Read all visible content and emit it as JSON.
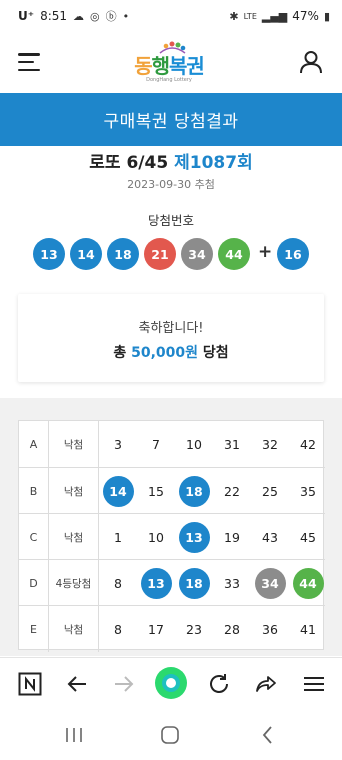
{
  "status_bar": {
    "carrier": "U⁺",
    "time": "8:51",
    "network": "LTE",
    "battery": "47%"
  },
  "header": {
    "logo_text_1": "동",
    "logo_text_2": "행",
    "logo_text_3": "복권",
    "logo_sub": "DongHang Lottery"
  },
  "title_bar": {
    "title": "구매복권 당첨결과"
  },
  "draw": {
    "name": "로또 6/45",
    "number": "제1087회",
    "date": "2023-09-30 추첨"
  },
  "winning": {
    "label": "당첨번호",
    "plus": "+",
    "balls": [
      {
        "n": "13",
        "color": "#1e86cb"
      },
      {
        "n": "14",
        "color": "#1e86cb"
      },
      {
        "n": "18",
        "color": "#1e86cb"
      },
      {
        "n": "21",
        "color": "#e2584e"
      },
      {
        "n": "34",
        "color": "#8c8c8c"
      },
      {
        "n": "44",
        "color": "#56b34a"
      }
    ],
    "bonus": {
      "n": "16",
      "color": "#1e86cb"
    }
  },
  "result": {
    "congrats": "축하합니다!",
    "prefix": "총",
    "amount": "50,000원",
    "suffix": "당첨"
  },
  "ticket": {
    "rows": [
      {
        "game": "A",
        "result": "낙첨",
        "numbers": [
          "3",
          "7",
          "10",
          "31",
          "32",
          "42"
        ],
        "matched": [
          null,
          null,
          null,
          null,
          null,
          null
        ]
      },
      {
        "game": "B",
        "result": "낙첨",
        "numbers": [
          "14",
          "15",
          "18",
          "22",
          "25",
          "35"
        ],
        "matched": [
          "#1e86cb",
          null,
          "#1e86cb",
          null,
          null,
          null
        ]
      },
      {
        "game": "C",
        "result": "낙첨",
        "numbers": [
          "1",
          "10",
          "13",
          "19",
          "43",
          "45"
        ],
        "matched": [
          null,
          null,
          "#1e86cb",
          null,
          null,
          null
        ]
      },
      {
        "game": "D",
        "result": "4등당첨",
        "numbers": [
          "8",
          "13",
          "18",
          "33",
          "34",
          "44"
        ],
        "matched": [
          null,
          "#1e86cb",
          "#1e86cb",
          null,
          "#8c8c8c",
          "#56b34a"
        ]
      },
      {
        "game": "E",
        "result": "낙첨",
        "numbers": [
          "8",
          "17",
          "23",
          "28",
          "36",
          "41"
        ],
        "matched": [
          null,
          null,
          null,
          null,
          null,
          null
        ]
      }
    ]
  },
  "browser_bar": {
    "items": [
      "n-icon",
      "back-icon",
      "forward-icon",
      "home-circle-icon",
      "refresh-icon",
      "share-icon",
      "menu-icon"
    ]
  },
  "nav_bar": {
    "items": [
      "recents-icon",
      "home-icon",
      "back-icon"
    ]
  }
}
